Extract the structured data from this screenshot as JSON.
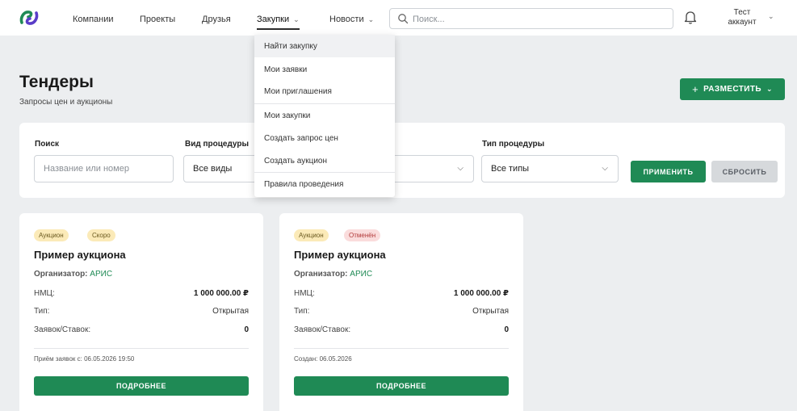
{
  "header": {
    "nav": [
      "Компании",
      "Проекты",
      "Друзья",
      "Закупки",
      "Новости"
    ],
    "search_placeholder": "Поиск...",
    "account_line1": "Тест",
    "account_line2": "аккаунт"
  },
  "purchases_menu": {
    "items": [
      "Найти закупку",
      "Мои заявки",
      "Мои приглашения",
      "Мои закупки",
      "Создать запрос цен",
      "Создать аукцион",
      "Правила проведения"
    ],
    "highlighted": "Найти закупку"
  },
  "page": {
    "title": "Тендеры",
    "subtitle": "Запросы цен и аукционы",
    "place_button": "РАЗМЕСТИТЬ"
  },
  "filters": {
    "search_label": "Поиск",
    "search_placeholder": "Название или номер",
    "kind_label": "Вид процедуры",
    "kind_value": "Все виды",
    "type_label": "Тип процедуры",
    "type_value": "Все типы",
    "apply": "ПРИМЕНИТЬ",
    "reset": "СБРОСИТЬ"
  },
  "cards": [
    {
      "badges": [
        "Аукцион",
        "Скоро"
      ],
      "title": "Пример аукциона",
      "org_label": "Организатор:",
      "org": "АРИС",
      "nmc_label": "НМЦ:",
      "nmc": "1 000 000.00 ₽",
      "type_label": "Тип:",
      "type": "Открытая",
      "bids_label": "Заявок/Ставок:",
      "bids": "0",
      "footer": "Приём заявок с: 06.05.2026 19:50",
      "button": "ПОДРОБНЕЕ"
    },
    {
      "badges": [
        "Аукцион",
        "Отменён"
      ],
      "title": "Пример аукциона",
      "org_label": "Организатор:",
      "org": "АРИС",
      "nmc_label": "НМЦ:",
      "nmc": "1 000 000.00 ₽",
      "type_label": "Тип:",
      "type": "Открытая",
      "bids_label": "Заявок/Ставок:",
      "bids": "0",
      "footer": "Создан: 06.05.2026",
      "button": "ПОДРОБНЕЕ"
    }
  ],
  "colors": {
    "accent": "#1f8a55",
    "badge_soon": "#fbeab8",
    "badge_cancelled": "#fadcdc",
    "background": "#eceef0"
  }
}
